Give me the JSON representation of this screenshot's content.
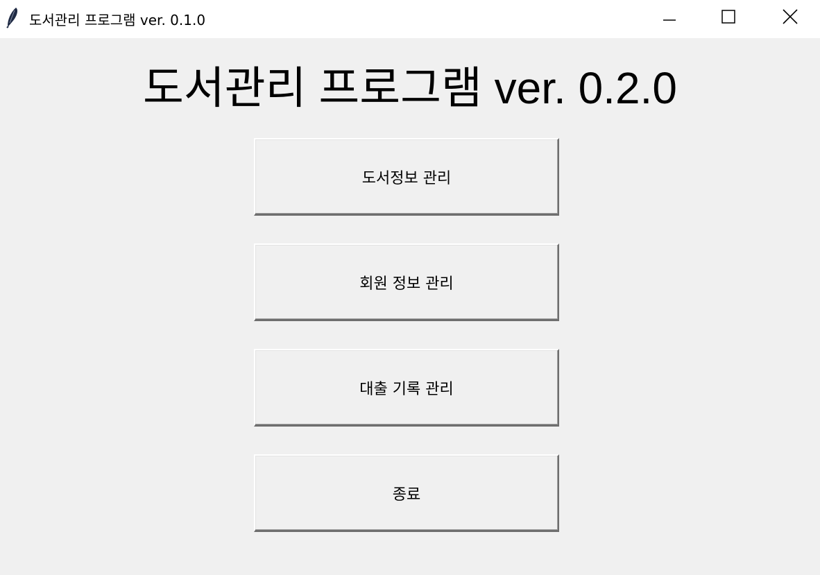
{
  "window": {
    "title": "도서관리 프로그램 ver. 0.1.0",
    "app_icon": "feather-icon",
    "controls": {
      "minimize_icon": "minimize-icon",
      "maximize_icon": "maximize-icon",
      "close_icon": "close-icon"
    }
  },
  "main": {
    "heading": "도서관리 프로그램 ver. 0.2.0",
    "buttons": [
      {
        "label": "도서정보 관리"
      },
      {
        "label": "회원 정보 관리"
      },
      {
        "label": "대출 기록 관리"
      },
      {
        "label": "종료"
      }
    ]
  },
  "colors": {
    "background": "#f0f0f0",
    "titlebar": "#ffffff",
    "text": "#000000"
  }
}
